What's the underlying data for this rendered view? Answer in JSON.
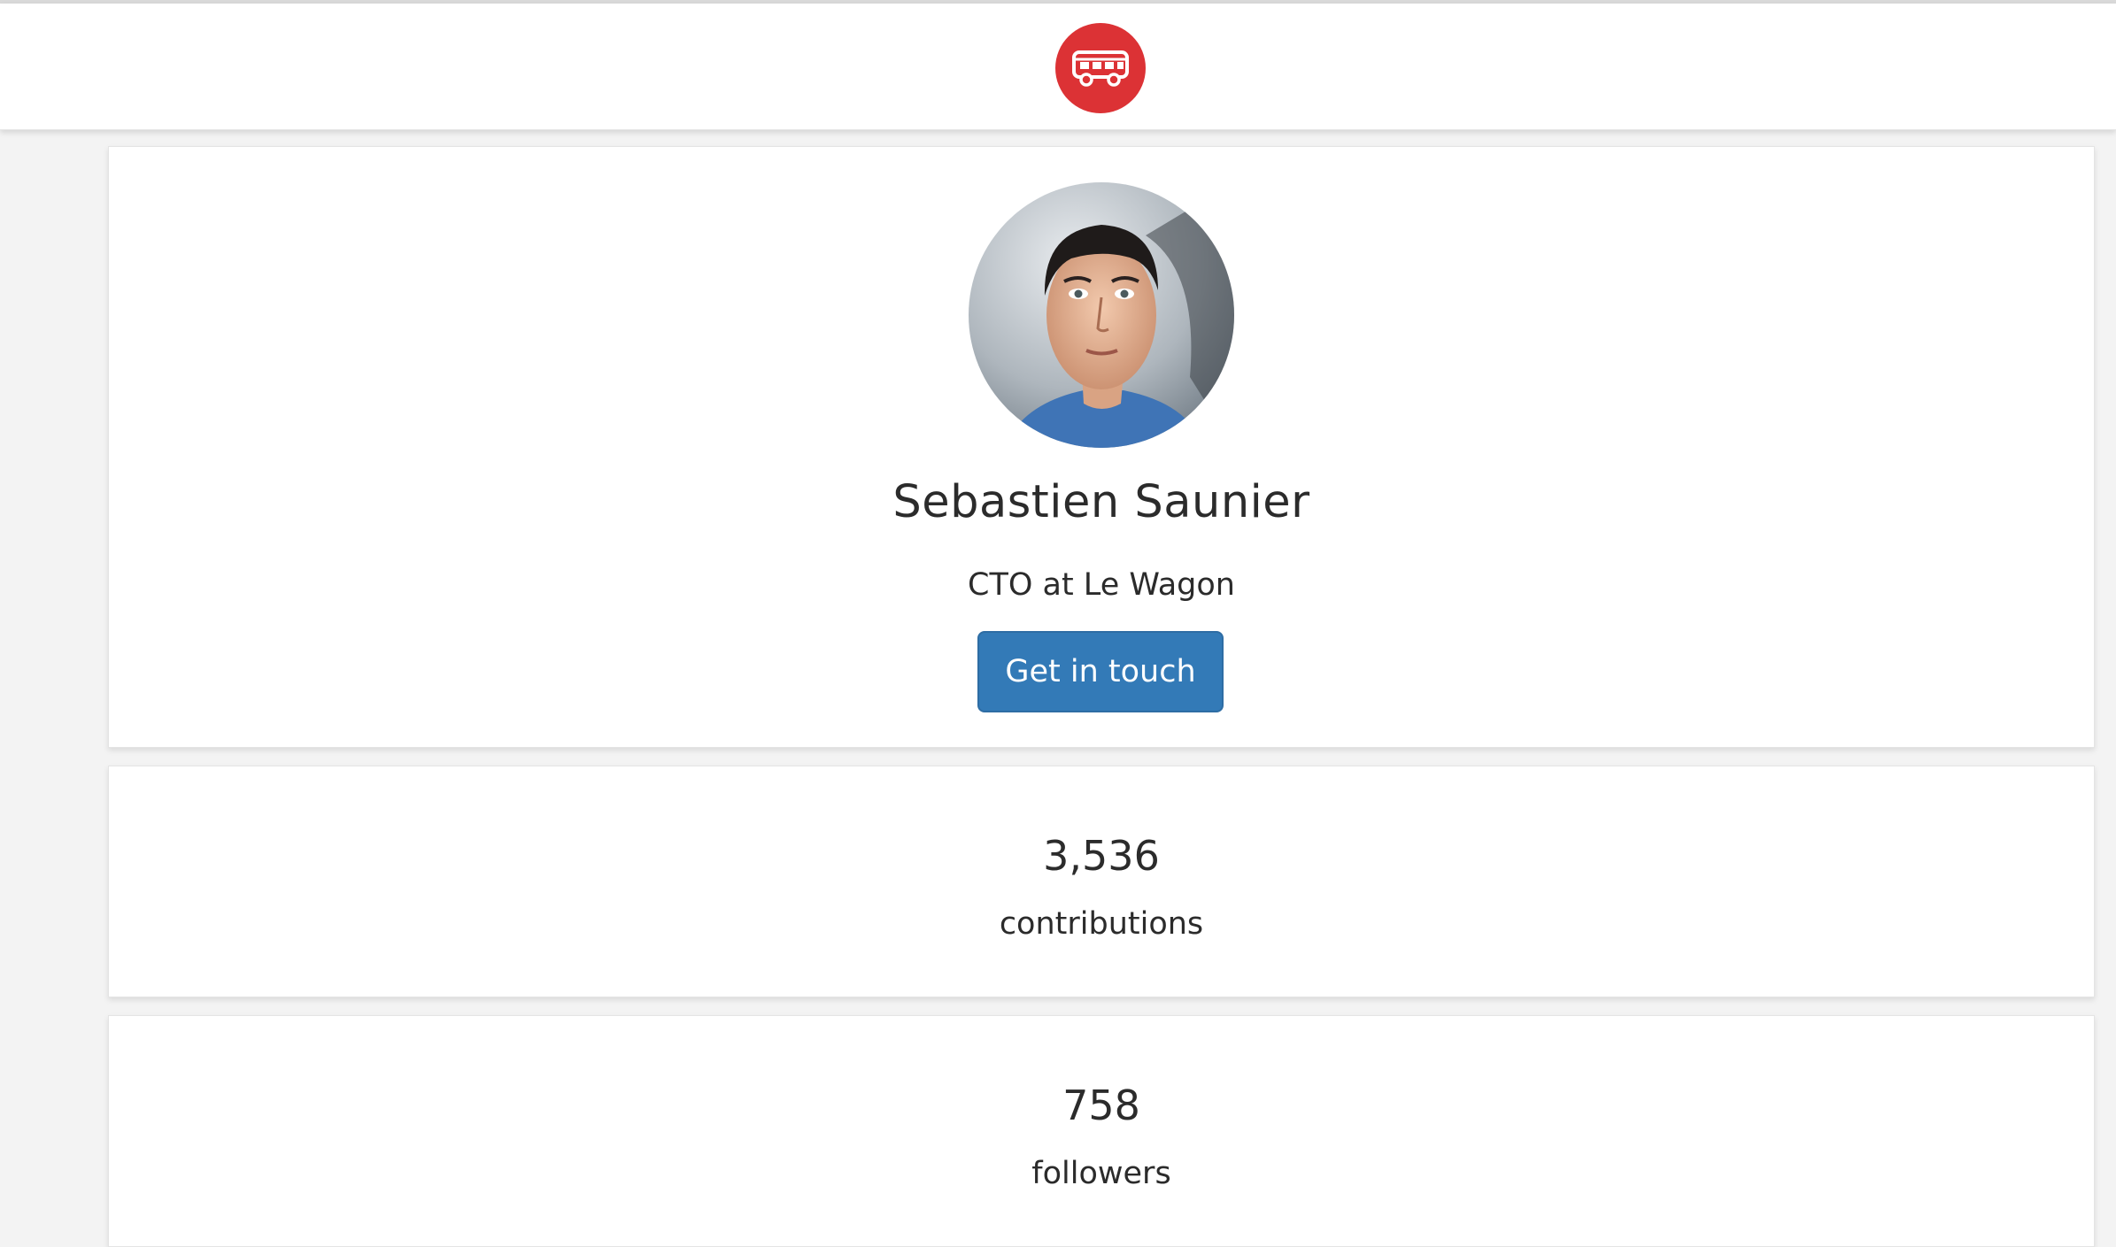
{
  "profile": {
    "name": "Sebastien Saunier",
    "role": "CTO at Le Wagon",
    "contact_button": "Get in touch"
  },
  "stats": [
    {
      "value": "3,536",
      "label": "contributions"
    },
    {
      "value": "758",
      "label": "followers"
    }
  ],
  "colors": {
    "brand_red": "#dc3235",
    "button_blue": "#337ab7",
    "background": "#f3f3f3"
  },
  "icons": {
    "logo": "bus-icon"
  }
}
